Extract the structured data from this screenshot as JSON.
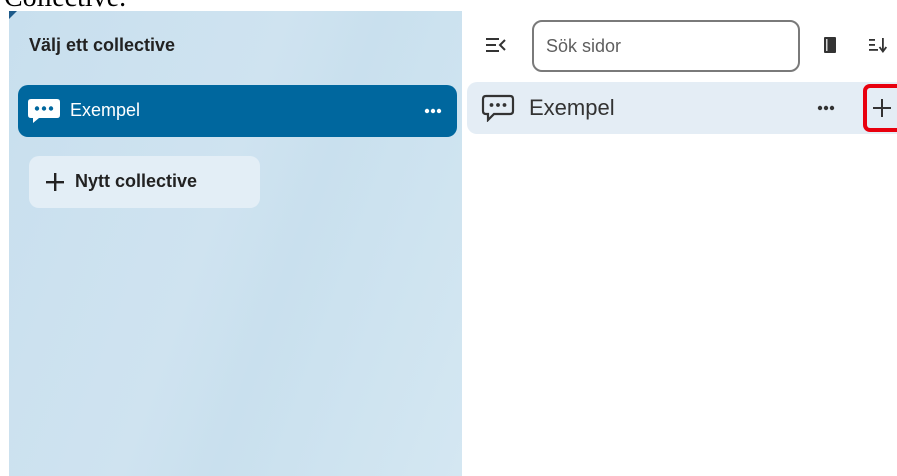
{
  "caption": "Collective.",
  "sidebar": {
    "heading": "Välj ett collective",
    "collectives": [
      {
        "label": "Exempel",
        "icon": "speech-bubble-icon",
        "selected": true
      }
    ],
    "new_collective_label": "Nytt collective"
  },
  "pagelist": {
    "search_placeholder": "Sök sidor",
    "search_value": "",
    "pages": [
      {
        "label": "Exempel",
        "icon": "speech-bubble-icon"
      }
    ]
  },
  "colors": {
    "sidebar_bg": "#cfe3f0",
    "selected_item_bg": "#00679e",
    "new_button_bg": "#e3eef6",
    "page_row_bg": "#e4edf5",
    "highlight_outline": "#e8000e"
  }
}
